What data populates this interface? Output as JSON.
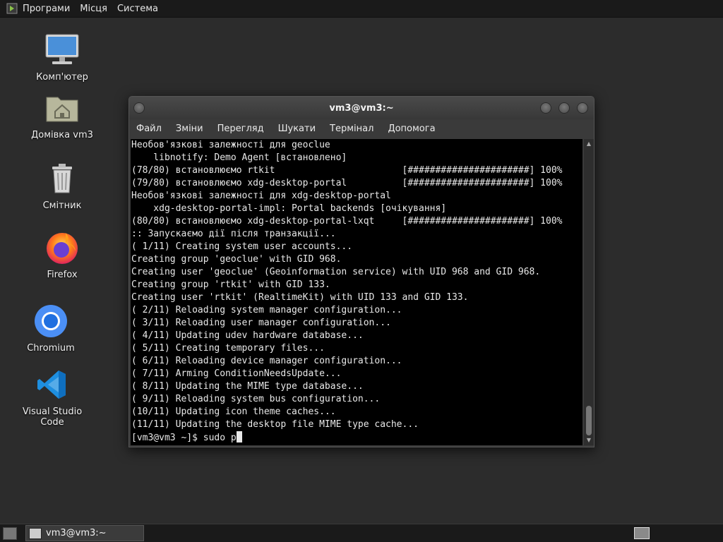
{
  "top_panel": {
    "menus": [
      "Програми",
      "Місця",
      "Система"
    ]
  },
  "desktop": {
    "icons": [
      {
        "label": "Комп'ютер",
        "icon": "computer-icon"
      },
      {
        "label": "Домівка vm3",
        "icon": "home-folder-icon"
      },
      {
        "label": "Смітник",
        "icon": "trash-icon"
      },
      {
        "label": "Firefox",
        "icon": "firefox-icon"
      },
      {
        "label": "Chromium",
        "icon": "chromium-icon"
      },
      {
        "label": "Visual Studio Code",
        "icon": "vscode-icon"
      }
    ]
  },
  "terminal": {
    "title": "vm3@vm3:~",
    "menu": [
      "Файл",
      "Зміни",
      "Перегляд",
      "Шукати",
      "Термінал",
      "Допомога"
    ],
    "lines": [
      "Необов'язкові залежності для geoclue",
      "    libnotify: Demo Agent [встановлено]",
      "(78/80) встановлюємо rtkit                       [######################] 100%",
      "(79/80) встановлюємо xdg-desktop-portal          [######################] 100%",
      "Необов'язкові залежності для xdg-desktop-portal",
      "    xdg-desktop-portal-impl: Portal backends [очікування]",
      "(80/80) встановлюємо xdg-desktop-portal-lxqt     [######################] 100%",
      ":: Запускаємо дії після транзакції...",
      "( 1/11) Creating system user accounts...",
      "Creating group 'geoclue' with GID 968.",
      "Creating user 'geoclue' (Geoinformation service) with UID 968 and GID 968.",
      "Creating group 'rtkit' with GID 133.",
      "Creating user 'rtkit' (RealtimeKit) with UID 133 and GID 133.",
      "( 2/11) Reloading system manager configuration...",
      "( 3/11) Reloading user manager configuration...",
      "( 4/11) Updating udev hardware database...",
      "( 5/11) Creating temporary files...",
      "( 6/11) Reloading device manager configuration...",
      "( 7/11) Arming ConditionNeedsUpdate...",
      "( 8/11) Updating the MIME type database...",
      "( 9/11) Reloading system bus configuration...",
      "(10/11) Updating icon theme caches...",
      "(11/11) Updating the desktop file MIME type cache..."
    ],
    "prompt": "[vm3@vm3 ~]$ sudo p"
  },
  "taskbar": {
    "window_button": "vm3@vm3:~"
  }
}
